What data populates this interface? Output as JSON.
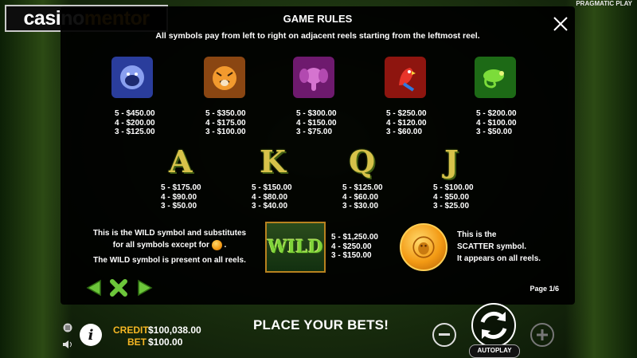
{
  "brand": {
    "logo_part1": "casino",
    "logo_part2": "mentor",
    "provider": "PRAGMATIC PLAY"
  },
  "rules": {
    "title": "GAME RULES",
    "subtitle": "All symbols pay from left to right on adjacent reels starting from the leftmost reel.",
    "high_symbols": [
      {
        "icon": "gorilla-icon",
        "color": "#3454c8",
        "pays": [
          "5 - $450.00",
          "4 - $200.00",
          "3 - $125.00"
        ]
      },
      {
        "icon": "tiger-icon",
        "color": "#d07a1a",
        "pays": [
          "5 - $350.00",
          "4 - $175.00",
          "3 - $100.00"
        ]
      },
      {
        "icon": "elephant-icon",
        "color": "#a02a9a",
        "pays": [
          "5 - $300.00",
          "4 - $150.00",
          "3 - $75.00"
        ]
      },
      {
        "icon": "parrot-icon",
        "color": "#c8261e",
        "pays": [
          "5 - $250.00",
          "4 - $120.00",
          "3 - $60.00"
        ]
      },
      {
        "icon": "chameleon-icon",
        "color": "#3aa62a",
        "pays": [
          "5 - $200.00",
          "4 - $100.00",
          "3 - $50.00"
        ]
      }
    ],
    "low_symbols": [
      {
        "letter": "A",
        "pays": [
          "5 - $175.00",
          "4 - $90.00",
          "3 - $50.00"
        ]
      },
      {
        "letter": "K",
        "pays": [
          "5 - $150.00",
          "4 - $80.00",
          "3 - $40.00"
        ]
      },
      {
        "letter": "Q",
        "pays": [
          "5 - $125.00",
          "4 - $60.00",
          "3 - $30.00"
        ]
      },
      {
        "letter": "J",
        "pays": [
          "5 - $100.00",
          "4 - $50.00",
          "3 - $25.00"
        ]
      }
    ],
    "wild": {
      "desc_line1": "This is the WILD symbol and substitutes",
      "desc_line2": "for all symbols except for",
      "desc_line2_end": ".",
      "desc_line3": "The WILD symbol is present on all reels.",
      "symbol_text": "WILD",
      "pays": [
        "5 - $1,250.00",
        "4 - $250.00",
        "3 - $150.00"
      ]
    },
    "scatter": {
      "desc_line1": "This is the",
      "desc_line2": "SCATTER symbol.",
      "desc_line3": "It appears on all reels."
    },
    "page": "Page 1/6",
    "close_icon": "close-icon"
  },
  "footer": {
    "credit_label": "CREDIT",
    "credit_value": "$100,038.00",
    "bet_label": "BET",
    "bet_value": "$100.00",
    "message": "PLACE YOUR BETS!",
    "autoplay_label": "AUTOPLAY"
  },
  "colors": {
    "accent": "#f5b624",
    "nav_green": "#6cc63a"
  }
}
